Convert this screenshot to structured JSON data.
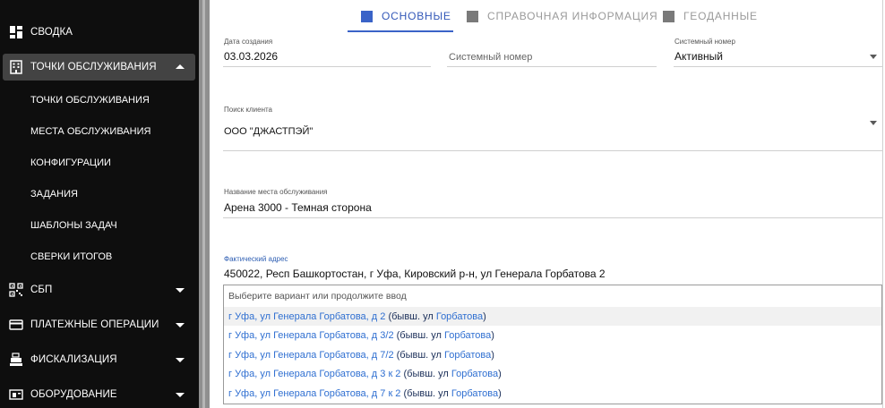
{
  "sidebar": {
    "items": [
      {
        "label": "Сводка",
        "icon": "dashboard-icon"
      },
      {
        "label": "Точки обслуживания",
        "icon": "building-icon",
        "expanded": true
      },
      {
        "label": "СБП",
        "icon": "qr-code-icon"
      },
      {
        "label": "Платежные операции",
        "icon": "credit-card-icon"
      },
      {
        "label": "Фискализация",
        "icon": "cash-register-icon"
      },
      {
        "label": "Оборудование",
        "icon": "equipment-icon"
      }
    ],
    "subitems": [
      "Точки обслуживания",
      "Места обслуживания",
      "Конфигурации",
      "Задания",
      "Шаблоны задач",
      "Сверки итогов"
    ]
  },
  "tabs": [
    {
      "label": "Основные",
      "active": true
    },
    {
      "label": "Справочная информация",
      "active": false
    },
    {
      "label": "Геоданные",
      "active": false
    }
  ],
  "form": {
    "created_label": "Дата создания",
    "created_value": "03.03.2026",
    "sysnum_placeholder": "Системный номер",
    "status_label": "Системный номер",
    "status_value": "Активный",
    "client_label": "Поиск клиента",
    "client_value": "ООО \"ДЖАСТПЭЙ\"",
    "place_label": "Название места обслуживания",
    "place_value": "Арена 3000 - Темная сторона",
    "address_label": "Фактический адрес",
    "address_value": "450022, Респ Башкортостан, г Уфа, Кировский р-н, ул Генерала Горбатова 2"
  },
  "suggestions": {
    "hint": "Выберите вариант или продолжите ввод",
    "options": [
      [
        {
          "t": "г Уфа, ул Генерала Горбатова, д 2",
          "c": "blue"
        },
        {
          "t": " (бывш. ул ",
          "c": "dark"
        },
        {
          "t": "Горбатова",
          "c": "blue"
        },
        {
          "t": ")",
          "c": "dark"
        }
      ],
      [
        {
          "t": "г Уфа, ул Генерала Горбатова, д 3/2",
          "c": "blue"
        },
        {
          "t": " (бывш. ул ",
          "c": "dark"
        },
        {
          "t": "Горбатова",
          "c": "blue"
        },
        {
          "t": ")",
          "c": "dark"
        }
      ],
      [
        {
          "t": "г Уфа, ул Генерала Горбатова, д 7/2",
          "c": "blue"
        },
        {
          "t": " (бывш. ул ",
          "c": "dark"
        },
        {
          "t": "Горбатова",
          "c": "blue"
        },
        {
          "t": ")",
          "c": "dark"
        }
      ],
      [
        {
          "t": "г Уфа, ул Генерала Горбатова, д 3 к 2",
          "c": "blue"
        },
        {
          "t": " (бывш. ул ",
          "c": "dark"
        },
        {
          "t": "Горбатова",
          "c": "blue"
        },
        {
          "t": ")",
          "c": "dark"
        }
      ],
      [
        {
          "t": "г Уфа, ул Генерала Горбатова, д 7 к 2",
          "c": "blue"
        },
        {
          "t": " (бывш. ул ",
          "c": "dark"
        },
        {
          "t": "Горбатова",
          "c": "blue"
        },
        {
          "t": ")",
          "c": "dark"
        }
      ]
    ]
  },
  "colors": {
    "sidebar_bg": "#0e0e0e",
    "active_item_bg": "#434343",
    "accent": "#3a63c8",
    "link": "#2f6fd1"
  }
}
